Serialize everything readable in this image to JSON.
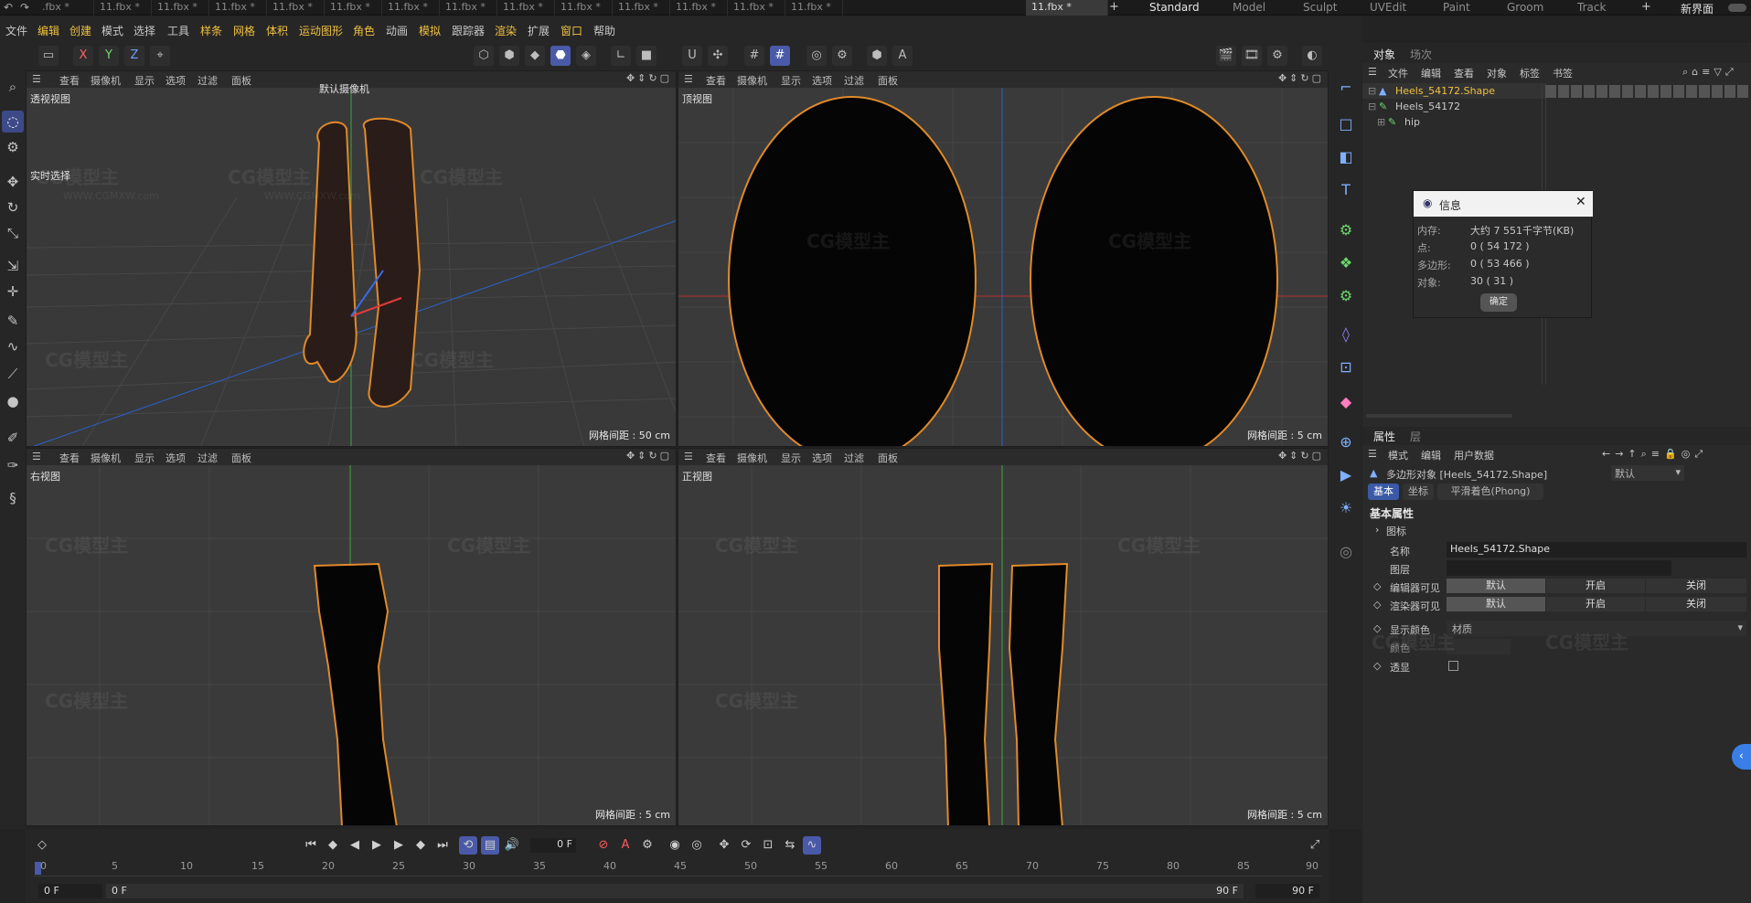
{
  "tabs": {
    "files": [
      " .fbx *",
      "11.fbx *",
      "11.fbx *",
      "11.fbx *",
      "11.fbx *",
      "11.fbx *",
      "11.fbx *",
      "11.fbx *",
      "11.fbx *",
      "11.fbx *",
      "11.fbx *",
      "11.fbx *",
      "11.fbx *",
      "11.fbx *",
      "11.fbx *"
    ],
    "layouts": [
      "Standard",
      "Model",
      "Sculpt",
      "UVEdit",
      "Paint",
      "Groom",
      "Track"
    ],
    "new_interface": "新界面"
  },
  "menu": [
    "文件",
    "编辑",
    "创建",
    "模式",
    "选择",
    "工具",
    "样条",
    "网格",
    "体积",
    "运动图形",
    "角色",
    "动画",
    "模拟",
    "跟踪器",
    "渲染",
    "扩展",
    "窗口",
    "帮助"
  ],
  "viewport_menu": [
    "查看",
    "摄像机",
    "显示",
    "选项",
    "过滤",
    "面板"
  ],
  "viewports": {
    "perspective": {
      "name": "透视视图",
      "camera": "默认摄像机",
      "grid": "网格间距 : 50 cm",
      "realtime": "实时选择"
    },
    "top": {
      "name": "顶视图",
      "grid": "网格间距 : 5 cm"
    },
    "right": {
      "name": "右视图",
      "grid": "网格间距 : 5 cm"
    },
    "front": {
      "name": "正视图",
      "grid": "网格间距 : 5 cm"
    }
  },
  "watermark": {
    "logo": "CG模型主",
    "url": "WWW.CGMXW.com"
  },
  "objects_panel": {
    "tabs": [
      "对象",
      "场次"
    ],
    "menu": [
      "文件",
      "编辑",
      "查看",
      "对象",
      "标签",
      "书签"
    ],
    "items": [
      {
        "name": "Heels_54172.Shape",
        "selected": true
      },
      {
        "name": "Heels_54172",
        "selected": false
      },
      {
        "name": "hip",
        "selected": false
      }
    ]
  },
  "info_dialog": {
    "title": "信息",
    "rows": [
      {
        "label": "内存:",
        "value": "大约 7 551千字节(KB)"
      },
      {
        "label": "点:",
        "value": "0 ( 54 172 )"
      },
      {
        "label": "多边形:",
        "value": "0 ( 53 466 )"
      },
      {
        "label": "对象:",
        "value": "30 ( 31 )"
      }
    ],
    "ok": "确定"
  },
  "attributes_panel": {
    "tabs": [
      "属性",
      "层"
    ],
    "menu": [
      "模式",
      "编辑",
      "用户数据"
    ],
    "object_label": "多边形对象 [Heels_54172.Shape]",
    "preset": "默认",
    "subtabs": [
      "基本",
      "坐标",
      "平滑着色(Phong)"
    ],
    "section": "基本属性",
    "icon_row": "图标",
    "name_label": "名称",
    "name_value": "Heels_54172.Shape",
    "layer_label": "图层",
    "editor_visible": "编辑器可见",
    "render_visible": "渲染器可见",
    "vis_options": [
      "默认",
      "开启",
      "关闭"
    ],
    "display_color": "显示颜色",
    "display_color_value": "材质",
    "color_label": "颜色",
    "transparent": "透显"
  },
  "timeline": {
    "ticks": [
      "0",
      "5",
      "10",
      "15",
      "20",
      "25",
      "30",
      "35",
      "40",
      "45",
      "50",
      "55",
      "60",
      "65",
      "70",
      "75",
      "80",
      "85",
      "90"
    ],
    "current_frame": "0 F",
    "start": "0 F",
    "start2": "0 F",
    "end": "90 F",
    "end2": "90 F"
  },
  "colors": {
    "accent": "#4a5aa8",
    "selected_object": "#f0c040",
    "highlight_outline": "#e08a2a"
  }
}
